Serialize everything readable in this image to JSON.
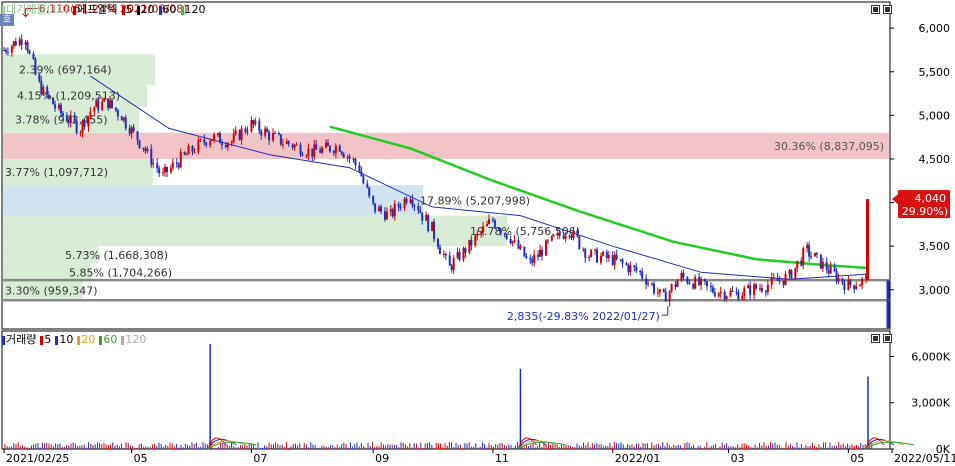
{
  "price_panel": {
    "corner_label": "호",
    "legend": [
      "대기매물(10)",
      "에프알텍",
      "5",
      "20",
      "60",
      "120"
    ],
    "y_ticks": [
      "6,000",
      "5,500",
      "5,000",
      "4,500",
      "4,000",
      "3,500",
      "3,000"
    ],
    "annotations": {
      "high": "6,110(51.24% 2021/03/08)",
      "low": "2,835(-29.83% 2022/01/27)"
    },
    "current_price": {
      "value": "4,040",
      "change": "( 29.90%)"
    }
  },
  "volume_panel": {
    "legend": [
      "거래량",
      "5",
      "10",
      "20",
      "60",
      "120"
    ],
    "y_ticks": [
      "6,000K",
      "3,000K",
      "0K"
    ]
  },
  "x_labels": [
    "2021/02/25",
    "05",
    "07",
    "09",
    "11",
    "2022/01",
    "03",
    "05",
    "2022/05/11"
  ],
  "colors": {
    "up": "#d40000",
    "down": "#1f2fbf",
    "ma5": "#d40000",
    "ma20": "#000000",
    "ma60": "#1f2fbf",
    "ma120": "#22cc22",
    "vp_green": "#d9edd6",
    "vp_red": "#f2c4c8",
    "vp_blue": "#cfe3f0",
    "support": "#888888",
    "axis": "#000000",
    "grid": "#b8b8b8"
  },
  "chart_data": {
    "type": "candlestick",
    "x_dates": [
      "2021-02-25",
      "2021-05",
      "2021-07",
      "2021-09",
      "2021-11",
      "2022-01",
      "2022-03",
      "2022-05",
      "2022-05-11"
    ],
    "ylim": [
      2550,
      6300
    ],
    "price_close_path": [
      [
        "2021-02-25",
        5750
      ],
      [
        "2021-03-08",
        5900
      ],
      [
        "2021-03-15",
        5350
      ],
      [
        "2021-03-25",
        5050
      ],
      [
        "2021-04-05",
        4850
      ],
      [
        "2021-04-12",
        5100
      ],
      [
        "2021-04-19",
        5150
      ],
      [
        "2021-04-26",
        5000
      ],
      [
        "2021-05-07",
        4650
      ],
      [
        "2021-05-17",
        4300
      ],
      [
        "2021-05-24",
        4450
      ],
      [
        "2021-06-01",
        4600
      ],
      [
        "2021-06-10",
        4750
      ],
      [
        "2021-06-21",
        4700
      ],
      [
        "2021-07-01",
        4900
      ],
      [
        "2021-07-15",
        4720
      ],
      [
        "2021-08-01",
        4580
      ],
      [
        "2021-08-15",
        4650
      ],
      [
        "2021-08-25",
        4400
      ],
      [
        "2021-09-01",
        3950
      ],
      [
        "2021-09-10",
        3850
      ],
      [
        "2021-09-20",
        4100
      ],
      [
        "2021-10-01",
        3700
      ],
      [
        "2021-10-10",
        3250
      ],
      [
        "2021-10-20",
        3500
      ],
      [
        "2021-11-01",
        3800
      ],
      [
        "2021-11-10",
        3600
      ],
      [
        "2021-11-20",
        3300
      ],
      [
        "2021-12-01",
        3550
      ],
      [
        "2021-12-10",
        3700
      ],
      [
        "2021-12-20",
        3400
      ],
      [
        "2022-01-01",
        3350
      ],
      [
        "2022-01-15",
        3200
      ],
      [
        "2022-01-27",
        2900
      ],
      [
        "2022-02-05",
        3150
      ],
      [
        "2022-02-20",
        3000
      ],
      [
        "2022-03-05",
        2950
      ],
      [
        "2022-03-20",
        3050
      ],
      [
        "2022-04-01",
        3150
      ],
      [
        "2022-04-10",
        3450
      ],
      [
        "2022-04-20",
        3250
      ],
      [
        "2022-05-01",
        3050
      ],
      [
        "2022-05-10",
        3110
      ],
      [
        "2022-05-11",
        4040
      ]
    ],
    "moving_averages": {
      "ma120": [
        [
          "2021-08-10",
          4870
        ],
        [
          "2021-09-20",
          4620
        ],
        [
          "2021-11-01",
          4250
        ],
        [
          "2021-12-15",
          3900
        ],
        [
          "2022-02-01",
          3550
        ],
        [
          "2022-03-15",
          3350
        ],
        [
          "2022-04-20",
          3280
        ],
        [
          "2022-05-11",
          3250
        ]
      ],
      "ma60": [
        [
          "2021-04-10",
          5450
        ],
        [
          "2021-05-20",
          4850
        ],
        [
          "2021-07-10",
          4550
        ],
        [
          "2021-08-20",
          4400
        ],
        [
          "2021-10-01",
          3950
        ],
        [
          "2021-11-15",
          3850
        ],
        [
          "2022-01-01",
          3500
        ],
        [
          "2022-02-15",
          3200
        ],
        [
          "2022-04-01",
          3120
        ],
        [
          "2022-05-11",
          3180
        ]
      ]
    },
    "volume_profile": [
      {
        "label": "3.30% (959,347)",
        "range": [
          2880,
          3100
        ],
        "color": "green"
      },
      {
        "label": "5.85% (1,704,266)",
        "range": [
          3100,
          3300
        ],
        "color": "green"
      },
      {
        "label": "5.73% (1,668,308)",
        "range": [
          3300,
          3500
        ],
        "color": "green"
      },
      {
        "label": "19.78% (5,756,506)",
        "range": [
          3500,
          3850
        ],
        "color": "green"
      },
      {
        "label": "17.89% (5,207,998)",
        "range": [
          3850,
          4200
        ],
        "color": "blue"
      },
      {
        "label": "3.77% (1,097,712)",
        "range": [
          4200,
          4500
        ],
        "color": "green"
      },
      {
        "label": "30.36% (8,837,095)",
        "range": [
          4500,
          4800
        ],
        "color": "red"
      },
      {
        "label": "3.78% (972,455)",
        "range": [
          4800,
          5100
        ],
        "color": "green"
      },
      {
        "label": "4.15% (1,209,513)",
        "range": [
          5100,
          5350
        ],
        "color": "green"
      },
      {
        "label": "2.39% (697,164)",
        "range": [
          5350,
          5700
        ],
        "color": "green"
      }
    ],
    "support_lines": [
      3110,
      2880
    ],
    "volume_spikes_k": [
      [
        "2021-06-10",
        6800
      ],
      [
        "2021-11-15",
        5200
      ],
      [
        "2022-05-11",
        4700
      ]
    ],
    "volume_ylim_k": [
      0,
      7000
    ]
  }
}
